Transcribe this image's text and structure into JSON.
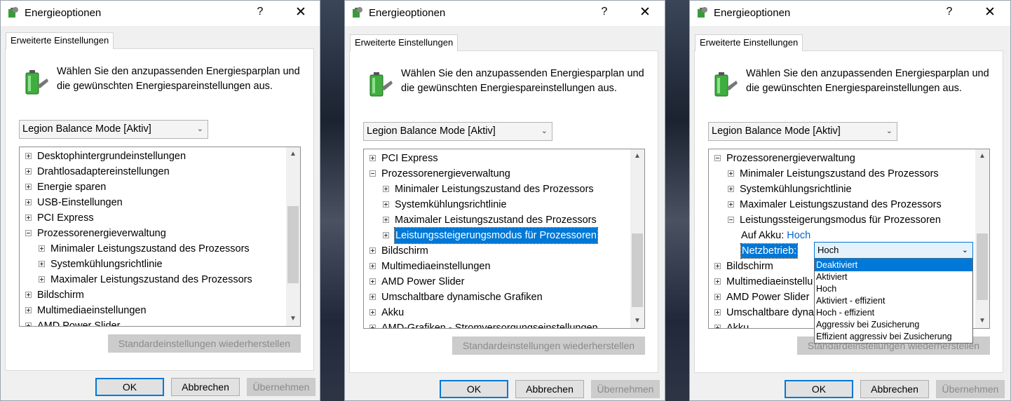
{
  "dialog": {
    "title": "Energieoptionen",
    "help": "?",
    "close": "✕",
    "tab": "Erweiterte Einstellungen",
    "description_line1": "Wählen Sie den anzupassenden Energiesparplan und",
    "description_line2": "die gewünschten Energiespareinstellungen aus.",
    "plan": "Legion Balance Mode  [Aktiv]",
    "restore": "Standardeinstellungen wiederherstellen",
    "ok": "OK",
    "cancel": "Abbrechen",
    "apply": "Übernehmen"
  },
  "tree1": [
    {
      "label": "Desktophintergrundeinstellungen",
      "level": 0,
      "exp": "plus"
    },
    {
      "label": "Drahtlosadaptereinstellungen",
      "level": 0,
      "exp": "plus"
    },
    {
      "label": "Energie sparen",
      "level": 0,
      "exp": "plus"
    },
    {
      "label": "USB-Einstellungen",
      "level": 0,
      "exp": "plus"
    },
    {
      "label": "PCI Express",
      "level": 0,
      "exp": "plus"
    },
    {
      "label": "Prozessorenergieverwaltung",
      "level": 0,
      "exp": "minus"
    },
    {
      "label": "Minimaler Leistungszustand des Prozessors",
      "level": 1,
      "exp": "plus"
    },
    {
      "label": "Systemkühlungsrichtlinie",
      "level": 1,
      "exp": "plus"
    },
    {
      "label": "Maximaler Leistungszustand des Prozessors",
      "level": 1,
      "exp": "plus"
    },
    {
      "label": "Bildschirm",
      "level": 0,
      "exp": "plus"
    },
    {
      "label": "Multimediaeinstellungen",
      "level": 0,
      "exp": "plus"
    },
    {
      "label": "AMD Power Slider",
      "level": 0,
      "exp": "plus"
    }
  ],
  "tree2": [
    {
      "label": "PCI Express",
      "level": 0,
      "exp": "plus"
    },
    {
      "label": "Prozessorenergieverwaltung",
      "level": 0,
      "exp": "minus"
    },
    {
      "label": "Minimaler Leistungszustand des Prozessors",
      "level": 1,
      "exp": "plus"
    },
    {
      "label": "Systemkühlungsrichtlinie",
      "level": 1,
      "exp": "plus"
    },
    {
      "label": "Maximaler Leistungszustand des Prozessors",
      "level": 1,
      "exp": "plus"
    },
    {
      "label": "Leistungssteigerungsmodus für Prozessoren",
      "level": 1,
      "exp": "plus",
      "selected": true
    },
    {
      "label": "Bildschirm",
      "level": 0,
      "exp": "plus"
    },
    {
      "label": "Multimediaeinstellungen",
      "level": 0,
      "exp": "plus"
    },
    {
      "label": "AMD Power Slider",
      "level": 0,
      "exp": "plus"
    },
    {
      "label": "Umschaltbare dynamische Grafiken",
      "level": 0,
      "exp": "plus"
    },
    {
      "label": "Akku",
      "level": 0,
      "exp": "plus"
    },
    {
      "label": "AMD-Grafiken - Stromversorgungseinstellungen",
      "level": 0,
      "exp": "plus"
    }
  ],
  "tree3": [
    {
      "label": "Prozessorenergieverwaltung",
      "level": 0,
      "exp": "minus"
    },
    {
      "label": "Minimaler Leistungszustand des Prozessors",
      "level": 1,
      "exp": "plus"
    },
    {
      "label": "Systemkühlungsrichtlinie",
      "level": 1,
      "exp": "plus"
    },
    {
      "label": "Maximaler Leistungszustand des Prozessors",
      "level": 1,
      "exp": "plus"
    },
    {
      "label": "Leistungssteigerungsmodus für Prozessoren",
      "level": 1,
      "exp": "minus"
    },
    {
      "label": "",
      "level": 2,
      "exp": "none",
      "kind": "akku"
    },
    {
      "label": "",
      "level": 2,
      "exp": "none",
      "kind": "netz"
    },
    {
      "label": "Bildschirm",
      "level": 0,
      "exp": "plus"
    },
    {
      "label": "Multimediaeinstellu",
      "level": 0,
      "exp": "plus"
    },
    {
      "label": "AMD Power Slider",
      "level": 0,
      "exp": "plus"
    },
    {
      "label": "Umschaltbare dyna",
      "level": 0,
      "exp": "plus"
    },
    {
      "label": "Akku",
      "level": 0,
      "exp": "plus"
    }
  ],
  "setting": {
    "battery_label": "Auf Akku:",
    "battery_value": "Hoch",
    "plugged_label": "Netzbetrieb:",
    "plugged_value": "Hoch",
    "options": [
      "Deaktiviert",
      "Aktiviert",
      "Hoch",
      "Aktiviert - effizient",
      "Hoch - effizient",
      "Aggressiv bei Zusicherung",
      "Effizient aggressiv bei Zusicherung"
    ],
    "highlighted_option": "Deaktiviert"
  },
  "colors": {
    "accent": "#0078d7",
    "link_value": "#0066cc"
  }
}
